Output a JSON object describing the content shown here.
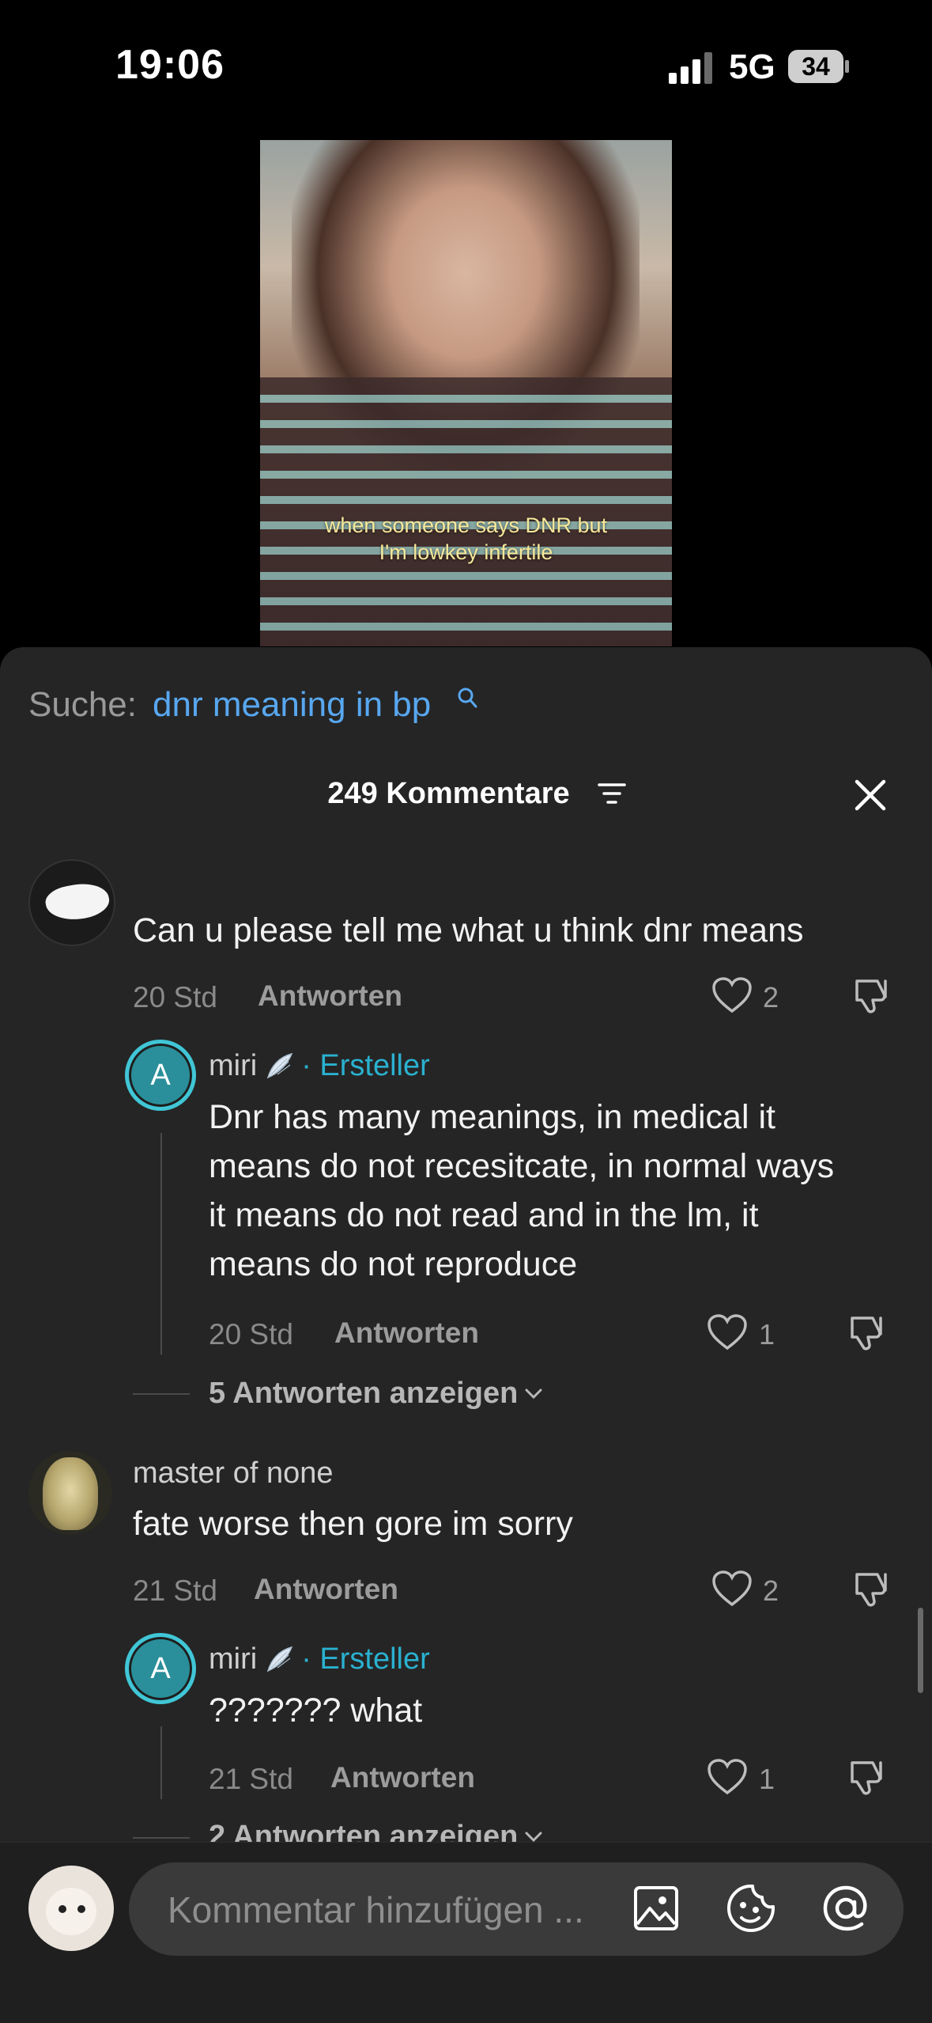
{
  "status_bar": {
    "time": "19:06",
    "network": "5G",
    "battery": "34"
  },
  "video": {
    "caption_line1": "when someone says DNR but",
    "caption_line2": "I'm lowkey infertile"
  },
  "search": {
    "prefix": "Suche:",
    "query": "dnr meaning in bp"
  },
  "comments_header": {
    "title": "249 Kommentare"
  },
  "comments": [
    {
      "username": "",
      "text": "Can u please tell me what u think dnr means",
      "time": "20 Std",
      "reply_label": "Antworten",
      "likes": "2",
      "replies": [
        {
          "avatar_letter": "A",
          "username": "miri",
          "creator_label": "· Ersteller",
          "text_lines": [
            "Dnr has many meanings, in medical it",
            "means do not recesitcate, in normal ways",
            "it means do not read and in the lm, it",
            "means do not reproduce"
          ],
          "time": "20 Std",
          "reply_label": "Antworten",
          "likes": "1"
        }
      ],
      "show_more": "5 Antworten anzeigen"
    },
    {
      "username": "master of none",
      "text": "fate worse then gore im sorry",
      "time": "21 Std",
      "reply_label": "Antworten",
      "likes": "2",
      "replies": [
        {
          "avatar_letter": "A",
          "username": "miri",
          "creator_label": "· Ersteller",
          "text": "??????? what",
          "time": "21 Std",
          "reply_label": "Antworten",
          "likes": "1"
        }
      ],
      "show_more": "2 Antworten anzeigen"
    }
  ],
  "input": {
    "placeholder": "Kommentar hinzufügen ..."
  },
  "icons": {
    "search": "search-icon",
    "filter": "filter-icon",
    "close": "close-icon",
    "heart": "heart-icon",
    "dislike": "dislike-icon",
    "wing": "wing-icon",
    "image": "image-icon",
    "emoji": "emoji-icon",
    "mention": "at-icon",
    "chevron": "chevron-down-icon"
  },
  "colors": {
    "accent_link": "#58a7f0",
    "creator": "#2ab1cf",
    "sheet_bg": "#252525"
  }
}
